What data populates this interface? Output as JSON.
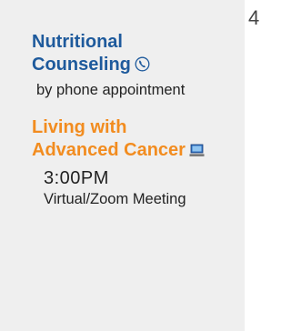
{
  "day": {
    "number": "4"
  },
  "events": [
    {
      "title_line1": "Nutritional",
      "title_line2": "Counseling",
      "icon": "phone-icon",
      "detail": "by phone appointment",
      "color": "#1e5a9c"
    },
    {
      "title_line1": "Living with",
      "title_line2": "Advanced Cancer",
      "icon": "computer-icon",
      "time": "3:00PM",
      "location": "Virtual/Zoom Meeting",
      "color": "#f28c1f"
    }
  ]
}
